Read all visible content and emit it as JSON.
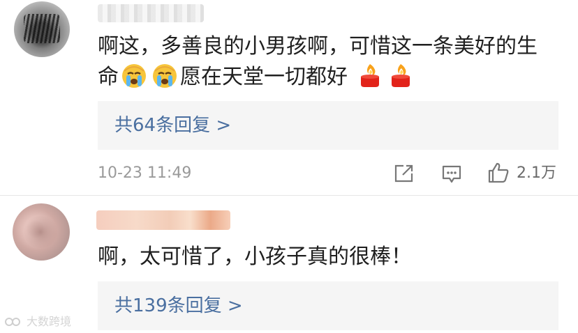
{
  "comments": [
    {
      "text_line1": "啊这，多善良的小男孩啊，可惜这一条美好的生",
      "text_line2_a": "命",
      "text_line2_b": "愿在天堂一切都好",
      "emojis": [
        "crying-face-icon",
        "crying-face-icon",
        "candle-icon",
        "candle-icon"
      ],
      "reply_link": "共64条回复 >",
      "time": "10-23 11:49",
      "like_count": "2.1万"
    },
    {
      "text": "啊，太可惜了，小孩子真的很棒！",
      "reply_link": "共139条回复 >"
    }
  ],
  "icons": {
    "share": "share-icon",
    "comment": "comment-icon",
    "like": "thumbs-up-icon"
  },
  "watermark": "大数跨境",
  "colors": {
    "reply_link": "#4a6fa0",
    "meta": "#9a9a9a",
    "reply_bg": "#f5f5f5"
  }
}
